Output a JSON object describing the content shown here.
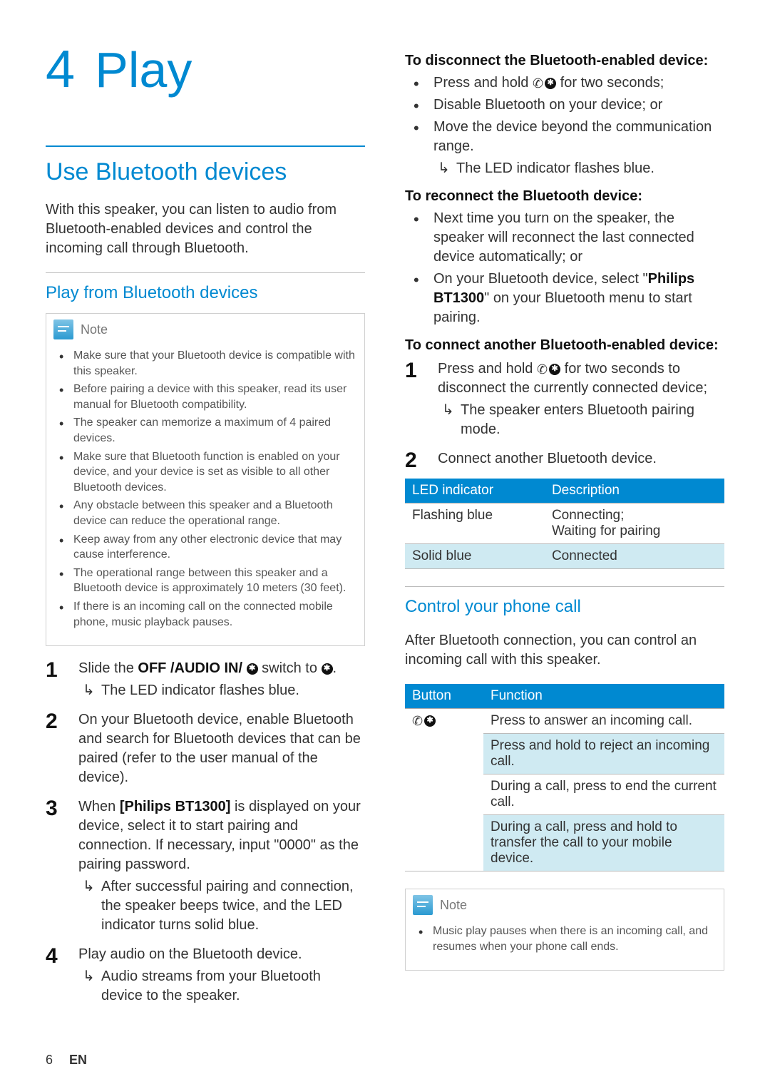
{
  "chapter": {
    "number": "4",
    "title": "Play"
  },
  "left": {
    "section_title": "Use Bluetooth devices",
    "intro": "With this speaker, you can listen to audio from Bluetooth-enabled devices and control the incoming call through Bluetooth.",
    "sub_title": "Play from Bluetooth devices",
    "note_label": "Note",
    "note_items": [
      "Make sure that your Bluetooth device is compatible with this speaker.",
      "Before pairing a device with this speaker, read its user manual for Bluetooth compatibility.",
      "The speaker can memorize a maximum of 4 paired devices.",
      "Make sure that Bluetooth function is enabled on your device, and your device is set as visible to all other Bluetooth devices.",
      "Any obstacle between this speaker and a Bluetooth device can reduce the operational range.",
      "Keep away from any other electronic device that may cause interference.",
      "The operational range between this speaker and a Bluetooth device is approximately 10 meters (30 feet).",
      "If there is an incoming call on the connected mobile phone, music playback pauses."
    ],
    "steps": [
      {
        "pre": "Slide the ",
        "bold": "OFF /AUDIO IN/ ",
        "post": " switch to ",
        "tail": ".",
        "result": "The LED indicator flashes blue."
      },
      {
        "text": "On your Bluetooth device, enable Bluetooth and search for Bluetooth devices that can be paired (refer to the user manual of the device)."
      },
      {
        "pre": "When ",
        "bold": "[Philips BT1300]",
        "post": " is displayed on your device, select it to start pairing and connection. If necessary, input \"0000\" as the pairing password.",
        "result": "After successful pairing and connection, the speaker beeps twice, and the LED indicator turns solid blue."
      },
      {
        "text": "Play audio on the Bluetooth device.",
        "result": "Audio streams from your Bluetooth device to the speaker."
      }
    ]
  },
  "right": {
    "disconnect_title": "To disconnect the Bluetooth-enabled device:",
    "disconnect_items": [
      {
        "pre": "Press and hold ",
        "post": " for two seconds;"
      },
      {
        "text": "Disable Bluetooth on your device; or"
      },
      {
        "text": "Move the device beyond the communication range.",
        "result": "The LED indicator flashes blue."
      }
    ],
    "reconnect_title": "To reconnect the Bluetooth device:",
    "reconnect_items": [
      {
        "text": "Next time you turn on the speaker, the speaker will reconnect the last connected device automatically; or"
      },
      {
        "pre": "On your Bluetooth device, select \"",
        "bold": "Philips BT1300",
        "post": "\" on your Bluetooth menu to start pairing."
      }
    ],
    "another_title": "To connect another Bluetooth-enabled device:",
    "another_steps": [
      {
        "pre": "Press and hold ",
        "post": " for two seconds to disconnect the currently connected device;",
        "result": "The speaker enters Bluetooth pairing mode."
      },
      {
        "text": "Connect another Bluetooth device."
      }
    ],
    "led_table": {
      "headers": [
        "LED indicator",
        "Description"
      ],
      "rows": [
        [
          "Flashing blue",
          "Connecting;\nWaiting for pairing"
        ],
        [
          "Solid blue",
          "Connected"
        ]
      ]
    },
    "call_title": "Control your phone call",
    "call_intro": "After Bluetooth connection, you can control an incoming call with this speaker.",
    "call_table": {
      "headers": [
        "Button",
        "Function"
      ],
      "rows": [
        "Press to answer an incoming call.",
        "Press and hold to reject an incoming call.",
        "During a call, press to end the current call.",
        "During a call, press and hold to transfer the call to your mobile device."
      ]
    },
    "note_label": "Note",
    "note_text": "Music play pauses when there is an incoming call, and resumes when your phone call ends."
  },
  "footer": {
    "page": "6",
    "lang": "EN"
  },
  "icons": {
    "note": "note-icon",
    "phonebt": "phone-bluetooth-icon",
    "bt": "bluetooth-icon",
    "result_arrow": "↳"
  }
}
